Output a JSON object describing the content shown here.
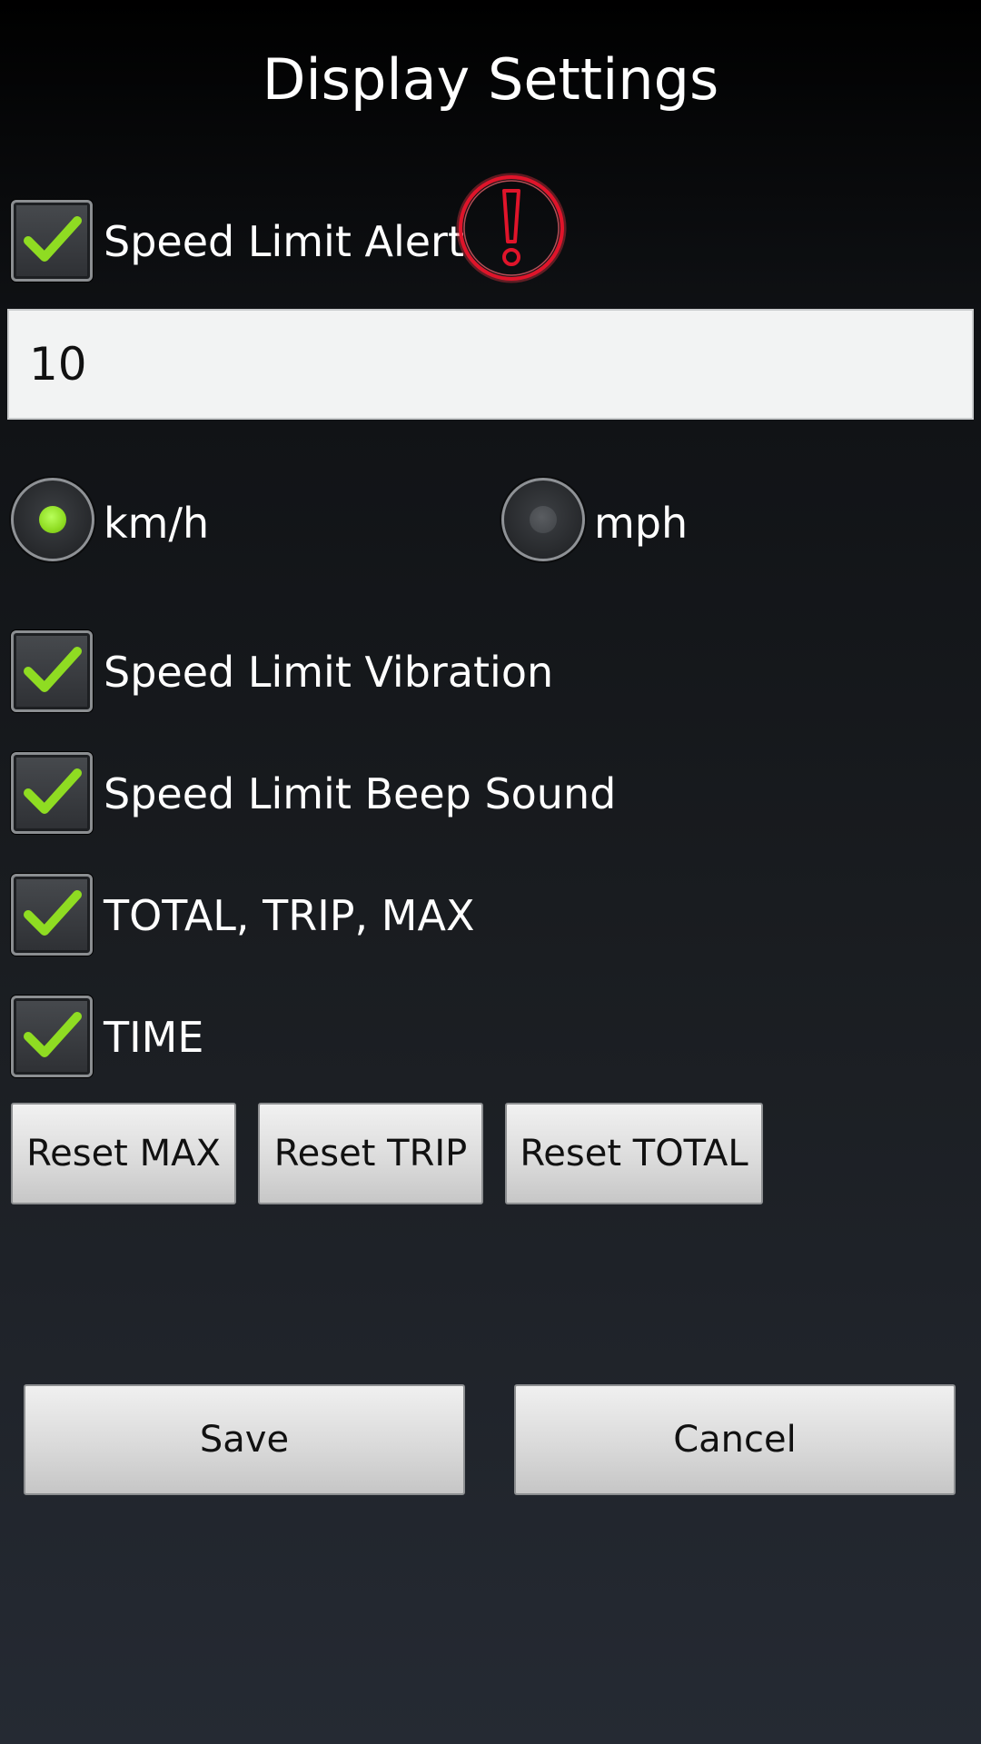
{
  "page_title": "Display Settings",
  "speed_limit_alert": {
    "label": "Speed Limit Alert",
    "checked": true,
    "icon": "alert-exclamation-icon",
    "icon_color": "#e0142a"
  },
  "speed_limit_value": "10",
  "units": {
    "options": [
      {
        "label": "km/h",
        "selected": true
      },
      {
        "label": "mph",
        "selected": false
      }
    ]
  },
  "options": [
    {
      "label": "Speed Limit Vibration",
      "checked": true
    },
    {
      "label": "Speed Limit Beep Sound",
      "checked": true
    },
    {
      "label": "TOTAL, TRIP, MAX",
      "checked": true
    },
    {
      "label": "TIME",
      "checked": true
    }
  ],
  "reset_buttons": {
    "max": "Reset MAX",
    "trip": "Reset TRIP",
    "total": "Reset TOTAL"
  },
  "actions": {
    "save": "Save",
    "cancel": "Cancel"
  },
  "colors": {
    "check": "#8fdc22",
    "alert": "#e0142a",
    "background_top": "#000000",
    "background_bottom": "#252a33"
  }
}
